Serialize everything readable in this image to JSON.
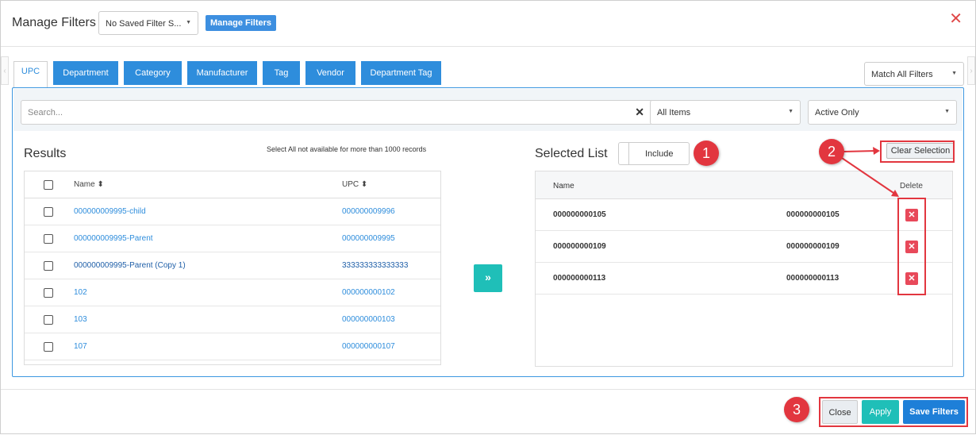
{
  "header": {
    "title": "Manage Filters",
    "saved_filter": "No Saved Filter S...",
    "manage_button": "Manage Filters"
  },
  "tabs": [
    "UPC",
    "Department",
    "Category",
    "Manufacturer",
    "Tag",
    "Vendor",
    "Department Tag"
  ],
  "match_select": "Match All Filters",
  "search": {
    "placeholder": "Search...",
    "items_filter": "All Items",
    "status_filter": "Active Only"
  },
  "results": {
    "title": "Results",
    "note": "Select All not available for more than 1000 records",
    "columns": {
      "name": "Name",
      "upc": "UPC"
    },
    "rows": [
      {
        "name": "000000009995-child",
        "upc": "000000009996"
      },
      {
        "name": "000000009995-Parent",
        "upc": "000000009995"
      },
      {
        "name": "000000009995-Parent (Copy 1)",
        "upc": "333333333333333"
      },
      {
        "name": "102",
        "upc": "000000000102"
      },
      {
        "name": "103",
        "upc": "000000000103"
      },
      {
        "name": "107",
        "upc": "000000000107"
      }
    ]
  },
  "selected": {
    "title": "Selected List",
    "include_label": "Include",
    "clear_label": "Clear Selection",
    "columns": {
      "name": "Name",
      "delete": "Delete"
    },
    "rows": [
      {
        "name": "000000000105",
        "upc": "000000000105"
      },
      {
        "name": "000000000109",
        "upc": "000000000109"
      },
      {
        "name": "000000000113",
        "upc": "000000000113"
      }
    ]
  },
  "footer": {
    "close": "Close",
    "apply": "Apply",
    "save": "Save Filters"
  },
  "annotations": [
    "1",
    "2",
    "3"
  ],
  "colors": {
    "tab_blue": "#2e8ddc",
    "teal": "#1fbfb8",
    "delete_red": "#e8495a",
    "annotation_red": "#e2363f"
  }
}
